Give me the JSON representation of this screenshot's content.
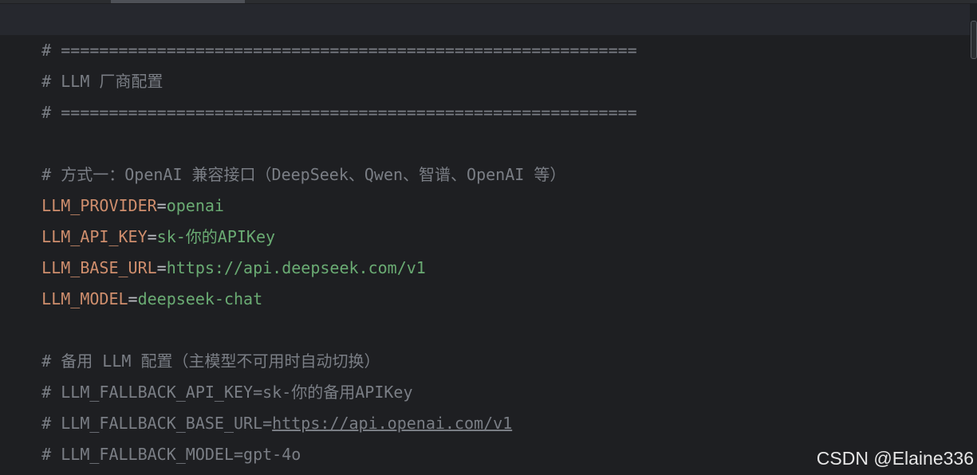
{
  "editor": {
    "lines": [
      {
        "type": "comment",
        "text": "# ============================================================"
      },
      {
        "type": "comment",
        "text": "# LLM 厂商配置"
      },
      {
        "type": "comment",
        "text": "# ============================================================"
      },
      {
        "type": "blank",
        "text": ""
      },
      {
        "type": "comment",
        "text": "# 方式一：OpenAI 兼容接口（DeepSeek、Qwen、智谱、OpenAI 等）"
      },
      {
        "type": "assign",
        "key": "LLM_PROVIDER",
        "eq": "=",
        "value": "openai"
      },
      {
        "type": "assign",
        "key": "LLM_API_KEY",
        "eq": "=",
        "value": "sk-你的APIKey"
      },
      {
        "type": "assign",
        "key": "LLM_BASE_URL",
        "eq": "=",
        "value": "https://api.deepseek.com/v1"
      },
      {
        "type": "assign",
        "key": "LLM_MODEL",
        "eq": "=",
        "value": "deepseek-chat"
      },
      {
        "type": "blank",
        "text": ""
      },
      {
        "type": "comment",
        "text": "# 备用 LLM 配置（主模型不可用时自动切换）"
      },
      {
        "type": "comment",
        "text": "# LLM_FALLBACK_API_KEY=sk-你的备用APIKey"
      },
      {
        "type": "comment_link",
        "prefix": "# LLM_FALLBACK_BASE_URL=",
        "link": "https://api.openai.com/v1"
      },
      {
        "type": "comment",
        "text": "# LLM_FALLBACK_MODEL=gpt-4o"
      }
    ]
  },
  "watermark": "CSDN @Elaine336",
  "colors": {
    "background": "#1e1f22",
    "current_line": "#26282e",
    "comment": "#7a7e85",
    "key": "#cf8e6d",
    "operator": "#bcbec4",
    "string_value": "#6aab73"
  }
}
